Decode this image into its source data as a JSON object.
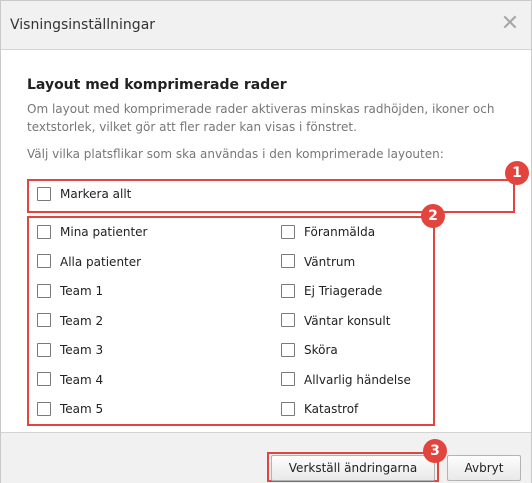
{
  "dialog": {
    "title": "Visningsinställningar",
    "close_icon": "close-icon"
  },
  "content": {
    "heading": "Layout med komprimerade rader",
    "description": "Om layout med komprimerade rader aktiveras minskas radhöjden, ikoner och textstorlek, vilket gör att fler rader kan visas i fönstret.",
    "prompt": "Välj vilka platsflikar som ska användas i den komprimerade layouten:",
    "select_all_label": "Markera allt",
    "left_options": [
      "Mina patienter",
      "Alla patienter",
      "Team 1",
      "Team 2",
      "Team 3",
      "Team 4",
      "Team 5"
    ],
    "right_options": [
      "Föranmälda",
      "Väntrum",
      "Ej Triagerade",
      "Väntar konsult",
      "Sköra",
      "Allvarlig händelse",
      "Katastrof"
    ]
  },
  "annotations": {
    "badge1": "1",
    "badge2": "2",
    "badge3": "3",
    "color": "#e2453d"
  },
  "footer": {
    "apply_label": "Verkställ ändringarna",
    "cancel_label": "Avbryt"
  }
}
